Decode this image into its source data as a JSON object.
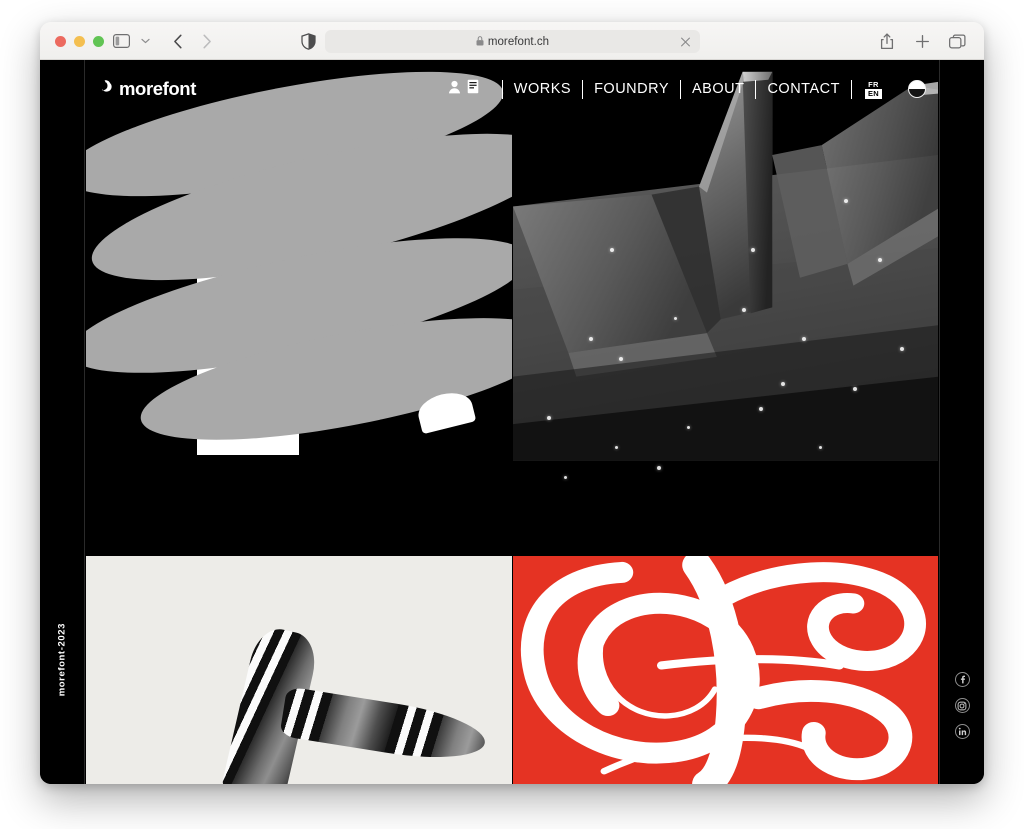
{
  "browser": {
    "traffic_lights": [
      "close",
      "minimize",
      "zoom"
    ],
    "sidebar_label": "Sidebar",
    "tab_overview_chevron": "chevron-down",
    "back_label": "Back",
    "forward_label": "Forward",
    "shield_label": "Privacy Report",
    "url": "morefont.ch",
    "url_lock": "lock-icon",
    "url_close": "close-icon",
    "share_label": "Share",
    "new_tab_label": "New Tab",
    "tabs_label": "Tab Overview"
  },
  "site": {
    "logo_text": "morefont",
    "logo_mark": "morefont-mark-icon",
    "nav": {
      "account_icon": "person-icon",
      "orders_icon": "document-icon",
      "links": [
        {
          "label": "WORKS"
        },
        {
          "label": "FOUNDRY"
        },
        {
          "label": "ABOUT"
        },
        {
          "label": "CONTACT"
        }
      ],
      "language": {
        "top": "FR",
        "bottom": "EN",
        "active": "EN"
      },
      "theme_toggle": "half-circle-theme-icon"
    },
    "vertical_credit": "morefont-2023",
    "socials": [
      {
        "name": "facebook",
        "glyph": "f"
      },
      {
        "name": "instagram",
        "glyph": "◎"
      },
      {
        "name": "linkedin",
        "glyph": "in"
      }
    ],
    "hero_tiles": [
      {
        "name": "letter-f-lens-tile",
        "kind": "typographic-letter-F"
      },
      {
        "name": "3d-metal-folds-tile",
        "kind": "3d-render"
      },
      {
        "name": "striped-legs-tile",
        "kind": "photograph"
      },
      {
        "name": "red-script-glyph-tile",
        "kind": "script-letterform"
      }
    ]
  },
  "colors": {
    "page_black": "#000000",
    "accent_red": "#e53323",
    "cream": "#edece8",
    "lens_gray": "#a9a9a9",
    "white": "#ffffff",
    "toolbar_bg": "#f6f5f4"
  }
}
